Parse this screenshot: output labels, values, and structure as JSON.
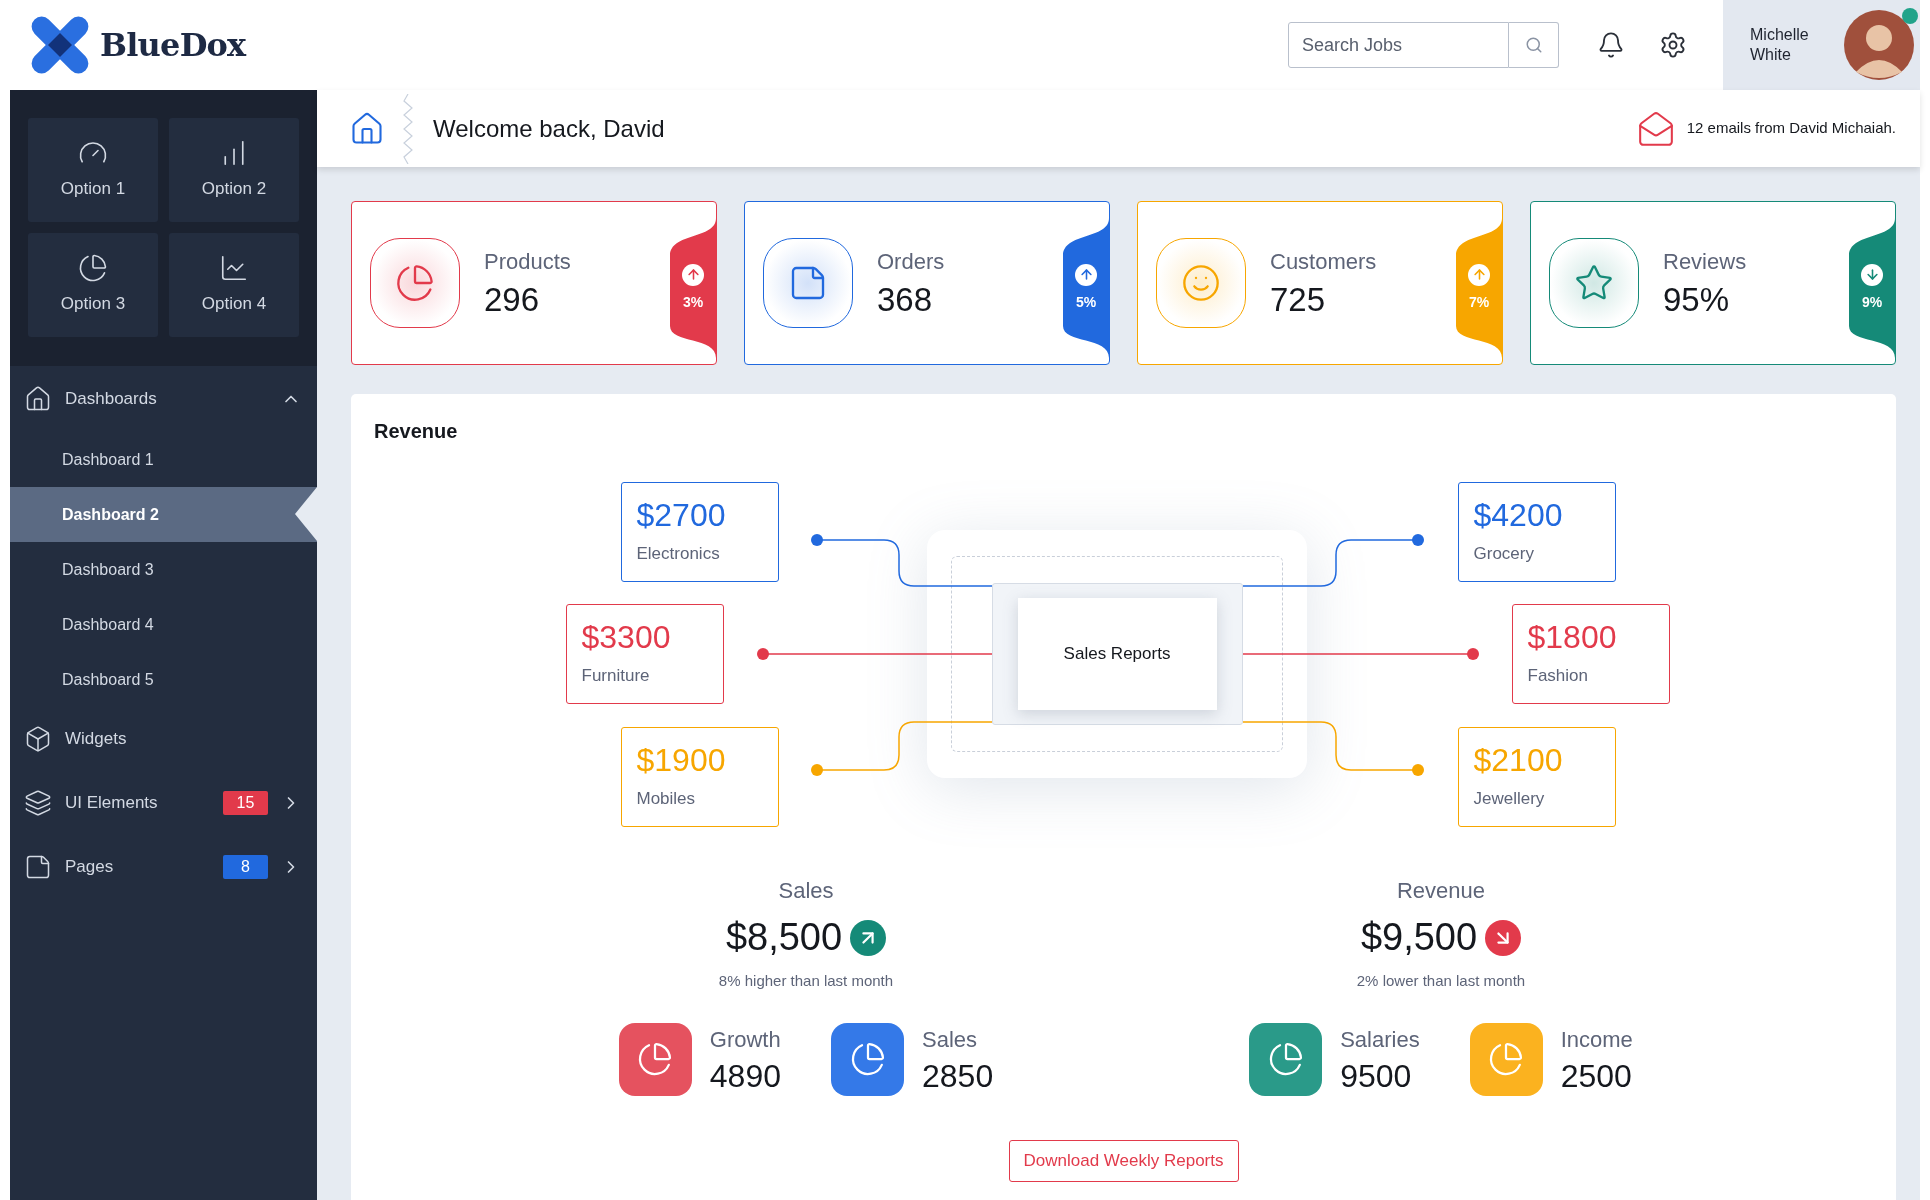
{
  "header": {
    "logo": "BlueDox",
    "search": {
      "placeholder": "Search Jobs"
    },
    "user": {
      "name": "Michelle White",
      "online": true
    }
  },
  "sidebar": {
    "options": [
      {
        "label": "Option 1"
      },
      {
        "label": "Option 2"
      },
      {
        "label": "Option 3"
      },
      {
        "label": "Option 4"
      }
    ],
    "nav": [
      {
        "label": "Dashboards",
        "expanded": true,
        "children": [
          {
            "label": "Dashboard 1",
            "selected": false
          },
          {
            "label": "Dashboard 2",
            "selected": true
          },
          {
            "label": "Dashboard 3",
            "selected": false
          },
          {
            "label": "Dashboard 4",
            "selected": false
          },
          {
            "label": "Dashboard 5",
            "selected": false
          }
        ]
      },
      {
        "label": "Widgets"
      },
      {
        "label": "UI Elements",
        "badge": "15",
        "color": "#e23a4b",
        "expanded": false
      },
      {
        "label": "Pages",
        "badge": "8",
        "color": "#2169de",
        "expanded": false
      }
    ]
  },
  "welcome": {
    "title": "Welcome back, David",
    "notice": "12 emails from David Michaiah."
  },
  "stats": [
    {
      "label": "Products",
      "value": "296",
      "change": "3%",
      "kind": "up",
      "color": "#e23a4b"
    },
    {
      "label": "Orders",
      "value": "368",
      "change": "5%",
      "kind": "up",
      "color": "#2169de"
    },
    {
      "label": "Customers",
      "value": "725",
      "change": "7%",
      "kind": "up",
      "color": "#f7a600"
    },
    {
      "label": "Reviews",
      "value": "95%",
      "change": "9%",
      "kind": "down",
      "color": "#158a78"
    }
  ],
  "revenue": {
    "title": "Revenue",
    "center": "Sales Reports",
    "items": [
      {
        "amount": "$2700",
        "label": "Electronics",
        "color": "#2169de"
      },
      {
        "amount": "$4200",
        "label": "Grocery",
        "color": "#2169de"
      },
      {
        "amount": "$3300",
        "label": "Furniture",
        "color": "#e23a4b"
      },
      {
        "amount": "$1800",
        "label": "Fashion",
        "color": "#e23a4b"
      },
      {
        "amount": "$1900",
        "label": "Mobiles",
        "color": "#f7a600"
      },
      {
        "amount": "$2100",
        "label": "Jewellery",
        "color": "#f7a600"
      }
    ],
    "summaries": [
      {
        "label": "Sales",
        "amount": "$8,500",
        "kind": "up",
        "note": "8% higher than last month",
        "tiles": [
          {
            "label": "Growth",
            "value": "4890",
            "color": "#e5525f"
          },
          {
            "label": "Sales",
            "value": "2850",
            "color": "#3479e8"
          }
        ]
      },
      {
        "label": "Revenue",
        "amount": "$9,500",
        "kind": "down",
        "note": "2% lower than last month",
        "tiles": [
          {
            "label": "Salaries",
            "value": "9500",
            "color": "#2a9a89"
          },
          {
            "label": "Income",
            "value": "2500",
            "color": "#fbb21f"
          }
        ]
      }
    ],
    "button": "Download Weekly Reports"
  }
}
